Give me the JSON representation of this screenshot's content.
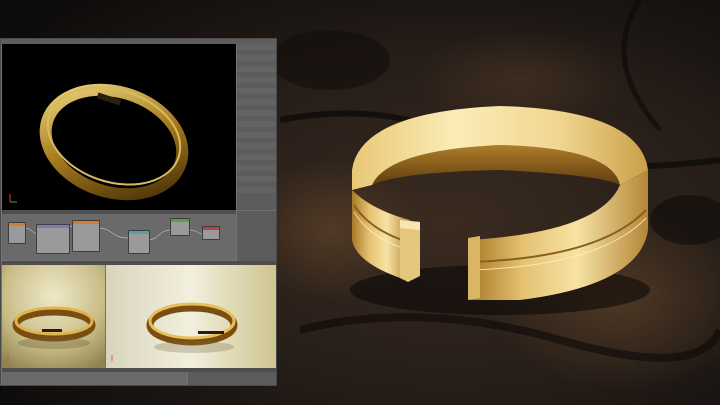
{
  "colors": {
    "gold_light": "#f6e4a2",
    "gold_mid": "#d4a43c",
    "gold_dark": "#6e4712",
    "rock_dark": "#1c1714",
    "rock_warm": "#4a3626",
    "ui_panel": "#727272",
    "ui_dark": "#4e4e4e",
    "viewport_bg": "#000000",
    "node_shader_header": "#d97a2c",
    "node_vector_header": "#7a7ab8",
    "node_converter_header": "#5aa0a0",
    "selection": "#5680c2"
  },
  "icons": {
    "axis_widget": "axis-gizmo-icon",
    "outliner_expand": "triangle-icon"
  },
  "ui": {
    "viewport_header": "",
    "outliner_rows": [
      "",
      "",
      "",
      "",
      "",
      "",
      "",
      "",
      "",
      "",
      "",
      "",
      "",
      "",
      "",
      "",
      "",
      "",
      "",
      "",
      "",
      "",
      "",
      "",
      "",
      "",
      "",
      ""
    ],
    "props_rows": [
      "",
      "",
      "",
      "",
      "",
      "",
      "",
      ""
    ],
    "outliner2_rows": [
      "",
      "",
      "",
      "",
      "",
      "",
      "",
      "",
      "",
      "",
      ""
    ]
  }
}
